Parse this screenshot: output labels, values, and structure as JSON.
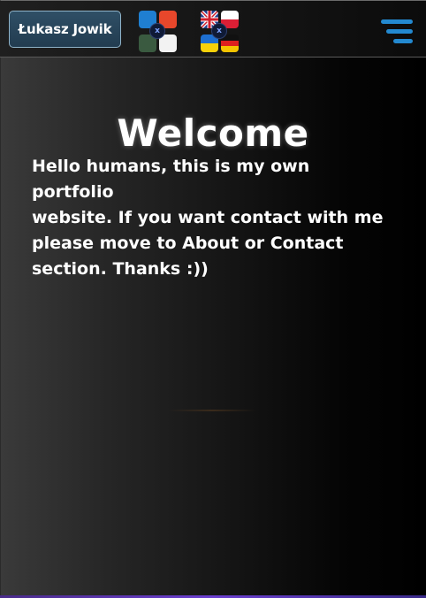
{
  "header": {
    "name_label": "Łukasz Jowik",
    "theme_switcher": {
      "icon": "color-theme-icon",
      "close_badge": "x",
      "colors": [
        "#1f7fd1",
        "#e8472b",
        "#3a5a40",
        "#f2f2f2"
      ]
    },
    "language_switcher": {
      "icon": "language-flags-icon",
      "close_badge": "x",
      "flags": [
        "uk",
        "pl",
        "ua",
        "de"
      ]
    },
    "menu_icon": "hamburger-menu-icon",
    "accent_color": "#2389d0"
  },
  "main": {
    "title": "Welcome",
    "intro_lines": [
      "Hello humans, this is my own portfolio",
      "website. If you want contact with me",
      "please move to About or Contact",
      "section. Thanks :))"
    ]
  }
}
